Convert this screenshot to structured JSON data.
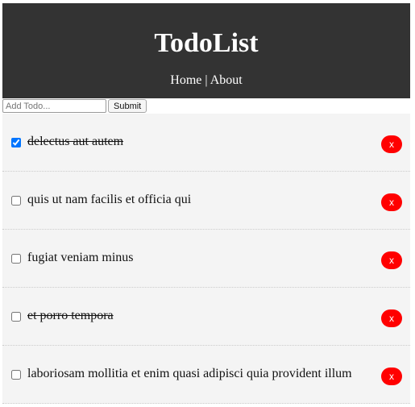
{
  "header": {
    "title": "TodoList",
    "nav": {
      "home": "Home",
      "separator": " | ",
      "about": "About"
    }
  },
  "form": {
    "placeholder": "Add Todo...",
    "submit_label": "Submit"
  },
  "colors": {
    "header_bg": "#333333",
    "delete_bg": "#ff0000",
    "list_bg": "#f4f4f4"
  },
  "todos": [
    {
      "title": "delectus aut autem",
      "completed": true,
      "delete_label": "x"
    },
    {
      "title": "quis ut nam facilis et officia qui",
      "completed": false,
      "delete_label": "x"
    },
    {
      "title": "fugiat veniam minus",
      "completed": false,
      "delete_label": "x"
    },
    {
      "title": "et porro tempora",
      "completed": false,
      "delete_label": "x"
    },
    {
      "title": "laboriosam mollitia et enim quasi adipisci quia provident illum",
      "completed": false,
      "delete_label": "x"
    }
  ]
}
